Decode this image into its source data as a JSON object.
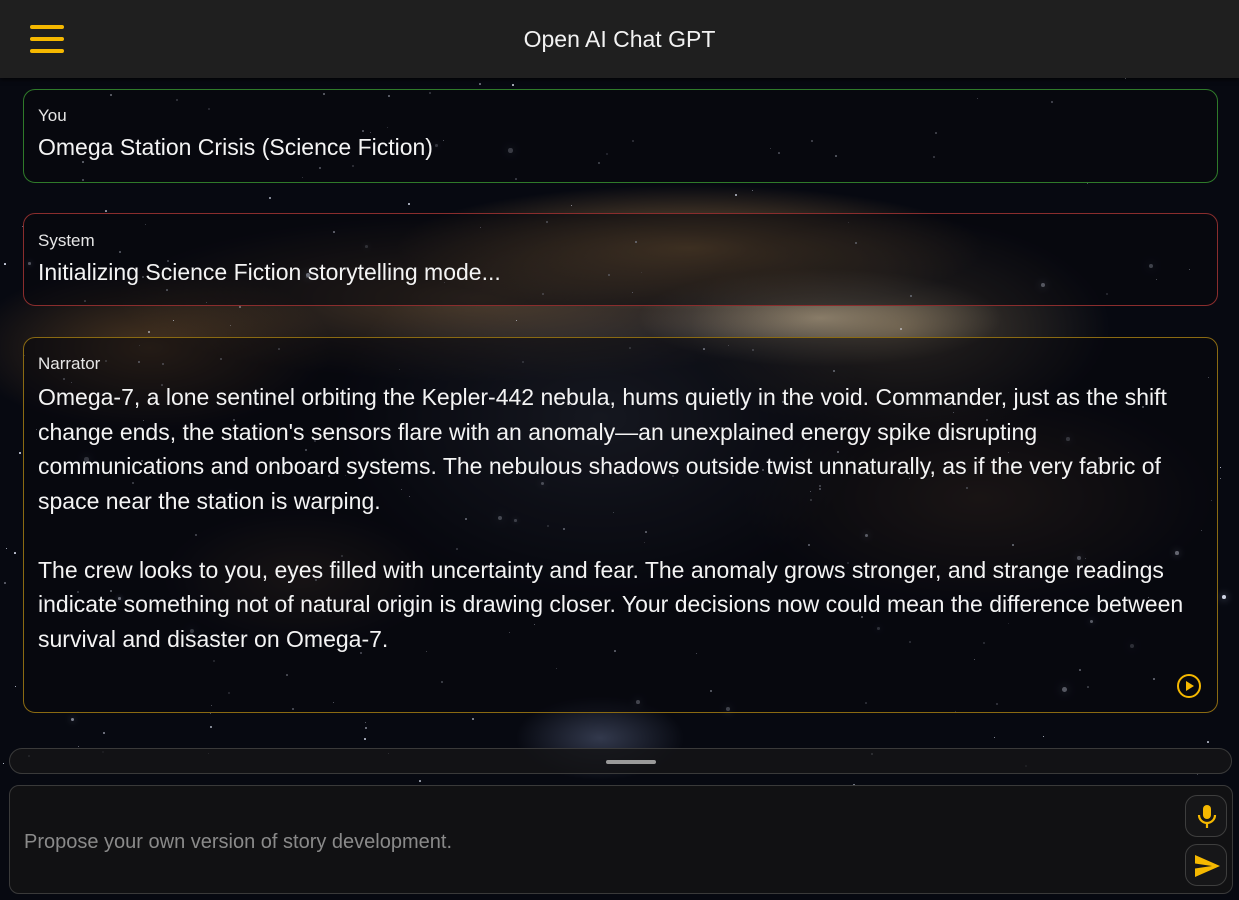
{
  "app": {
    "title": "Open AI Chat GPT"
  },
  "theme": {
    "accent": "#f5b800",
    "user_border": "#2f7a2a",
    "system_border": "#8a2d2d",
    "narrator_border": "#8a6a12"
  },
  "icons": {
    "menu": "hamburger-menu-icon",
    "play": "play-circle-icon",
    "mic": "microphone-icon",
    "send": "send-icon"
  },
  "messages": [
    {
      "role_label": "You",
      "text": "Omega Station Crisis (Science Fiction)"
    },
    {
      "role_label": "System",
      "text": "Initializing Science Fiction storytelling mode..."
    },
    {
      "role_label": "Narrator",
      "text": "Omega-7, a lone sentinel orbiting the Kepler-442 nebula, hums quietly in the void. Commander, just as the shift change ends, the station's sensors flare with an anomaly—an unexplained energy spike disrupting communications and onboard systems. The nebulous shadows outside twist unnaturally, as if the very fabric of space near the station is warping.\n\nThe crew looks to you, eyes filled with uncertainty and fear. The anomaly grows stronger, and strange readings indicate something not of natural origin is drawing closer. Your decisions now could mean the difference between survival and disaster on Omega-7."
    }
  ],
  "composer": {
    "placeholder": "Propose your own version of story development."
  }
}
